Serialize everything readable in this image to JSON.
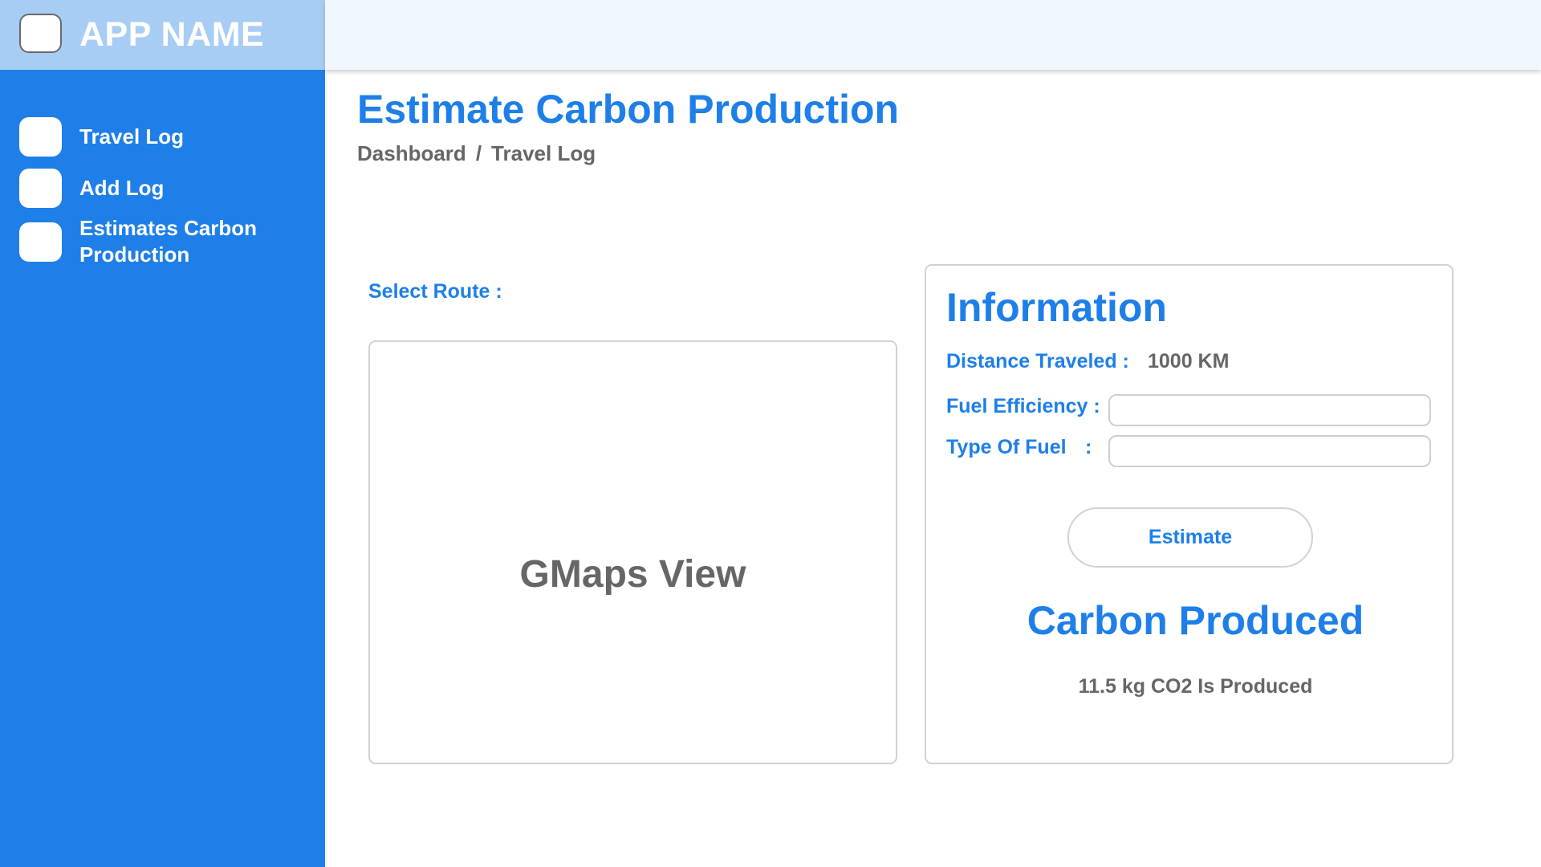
{
  "app": {
    "name": "APP NAME"
  },
  "sidebar": {
    "items": [
      {
        "label": "Travel Log"
      },
      {
        "label": "Add Log"
      },
      {
        "label_line1": "Estimates Carbon",
        "label_line2": "Production"
      }
    ]
  },
  "page": {
    "title": "Estimate Carbon Production",
    "breadcrumb": [
      "Dashboard",
      "/",
      "Travel Log"
    ]
  },
  "route": {
    "label": "Select Route :",
    "map_placeholder": "GMaps View"
  },
  "info": {
    "title": "Information",
    "distance_label": "Distance Traveled :",
    "distance_value": "1000 KM",
    "fuel_efficiency_label": "Fuel Efficiency :",
    "fuel_efficiency_value": "",
    "fuel_type_label": "Type Of Fuel",
    "fuel_type_colon": ":",
    "fuel_type_value": "",
    "estimate_button": "Estimate",
    "carbon_title": "Carbon Produced",
    "carbon_result": "11.5 kg CO2 Is Produced"
  },
  "colors": {
    "primary": "#1e7fe8",
    "brand_bg": "#a8cdf5",
    "topbar_bg": "#eff6fe",
    "muted_text": "#666666",
    "border": "#d2d2d2"
  },
  "icons": {
    "logo": "app-logo-icon",
    "nav": [
      "travel-log-icon",
      "add-log-icon",
      "estimate-carbon-icon"
    ]
  }
}
